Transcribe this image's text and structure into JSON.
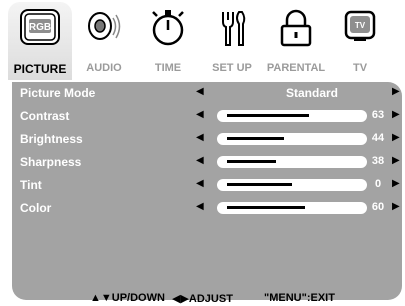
{
  "tabs": [
    {
      "label": "PICTURE",
      "icon": "rgb-picture-icon",
      "active": true
    },
    {
      "label": "AUDIO",
      "icon": "speaker-icon",
      "active": false
    },
    {
      "label": "TIME",
      "icon": "stopwatch-icon",
      "active": false
    },
    {
      "label": "SET UP",
      "icon": "tools-icon",
      "active": false
    },
    {
      "label": "PARENTAL",
      "icon": "padlock-icon",
      "active": false
    },
    {
      "label": "TV",
      "icon": "tv-icon",
      "active": false
    }
  ],
  "rgb_text": "RGB",
  "tv_text": "TV",
  "mode": {
    "label": "Picture Mode",
    "value": "Standard"
  },
  "settings": [
    {
      "label": "Contrast",
      "value": "63",
      "level": 0.63
    },
    {
      "label": "Brightness",
      "value": "44",
      "level": 0.44
    },
    {
      "label": "Sharpness",
      "value": "38",
      "level": 0.38
    },
    {
      "label": "Tint",
      "value": "0",
      "level": 0.5
    },
    {
      "label": "Color",
      "value": "60",
      "level": 0.6
    }
  ],
  "footer": {
    "updown": "▲▼UP/DOWN",
    "adjust": "◀▶ADJUST",
    "exit": "\"MENU\":EXIT"
  },
  "colors": {
    "panel": "#a3a3a3",
    "active_tab": "#e6e6e6",
    "inactive_label": "#9b9b9b"
  }
}
